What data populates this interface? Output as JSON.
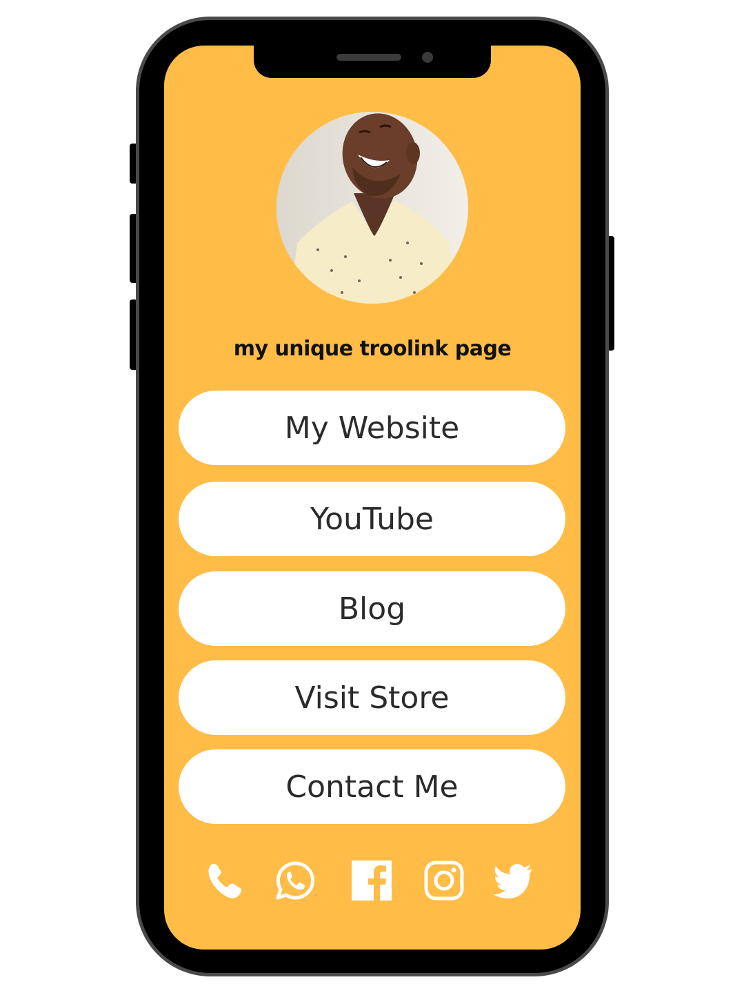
{
  "page": {
    "title": "my unique troolink page",
    "background_color": "#ffbc47",
    "button_color": "#ffffff",
    "button_text_color": "#2b2b2b"
  },
  "avatar": {
    "description_icon": "profile-photo"
  },
  "links": [
    {
      "label": "My Website"
    },
    {
      "label": "YouTube"
    },
    {
      "label": "Blog"
    },
    {
      "label": "Visit Store"
    },
    {
      "label": "Contact Me"
    }
  ],
  "social": [
    {
      "icon": "phone-icon"
    },
    {
      "icon": "whatsapp-icon"
    },
    {
      "icon": "facebook-icon"
    },
    {
      "icon": "instagram-icon"
    },
    {
      "icon": "twitter-icon"
    }
  ]
}
